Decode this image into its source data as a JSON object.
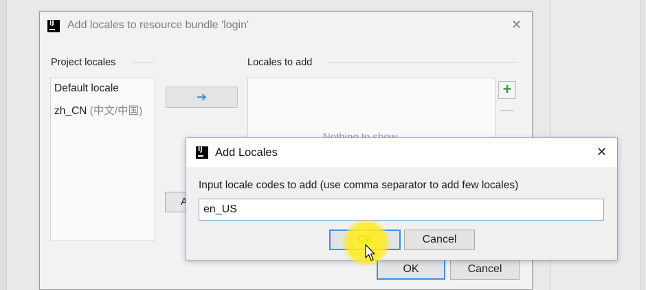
{
  "main_dialog": {
    "title": "Add locales to resource bundle 'login'",
    "project_locales_label": "Project locales",
    "locales_to_add_label": "Locales to add",
    "project_locales": [
      {
        "name": "Default locale",
        "note": ""
      },
      {
        "name": "zh_CN",
        "note": "(中文/中国)"
      }
    ],
    "empty_text": "Nothing to show",
    "partial_button_label": "A",
    "ok_label": "OK",
    "cancel_label": "Cancel"
  },
  "child_dialog": {
    "title": "Add Locales",
    "prompt": "Input locale codes to add (use comma separator to add few locales)",
    "input_value": "en_US",
    "ok_label": "OK",
    "cancel_label": "Cancel"
  },
  "icons": {
    "app_logo": "IJ",
    "close": "✕",
    "move_right": "➔",
    "add": "+",
    "remove": "—"
  },
  "colors": {
    "accent": "#3d8ee0",
    "add_icon": "#3a9a3a",
    "highlight": "#ffeb1e"
  }
}
